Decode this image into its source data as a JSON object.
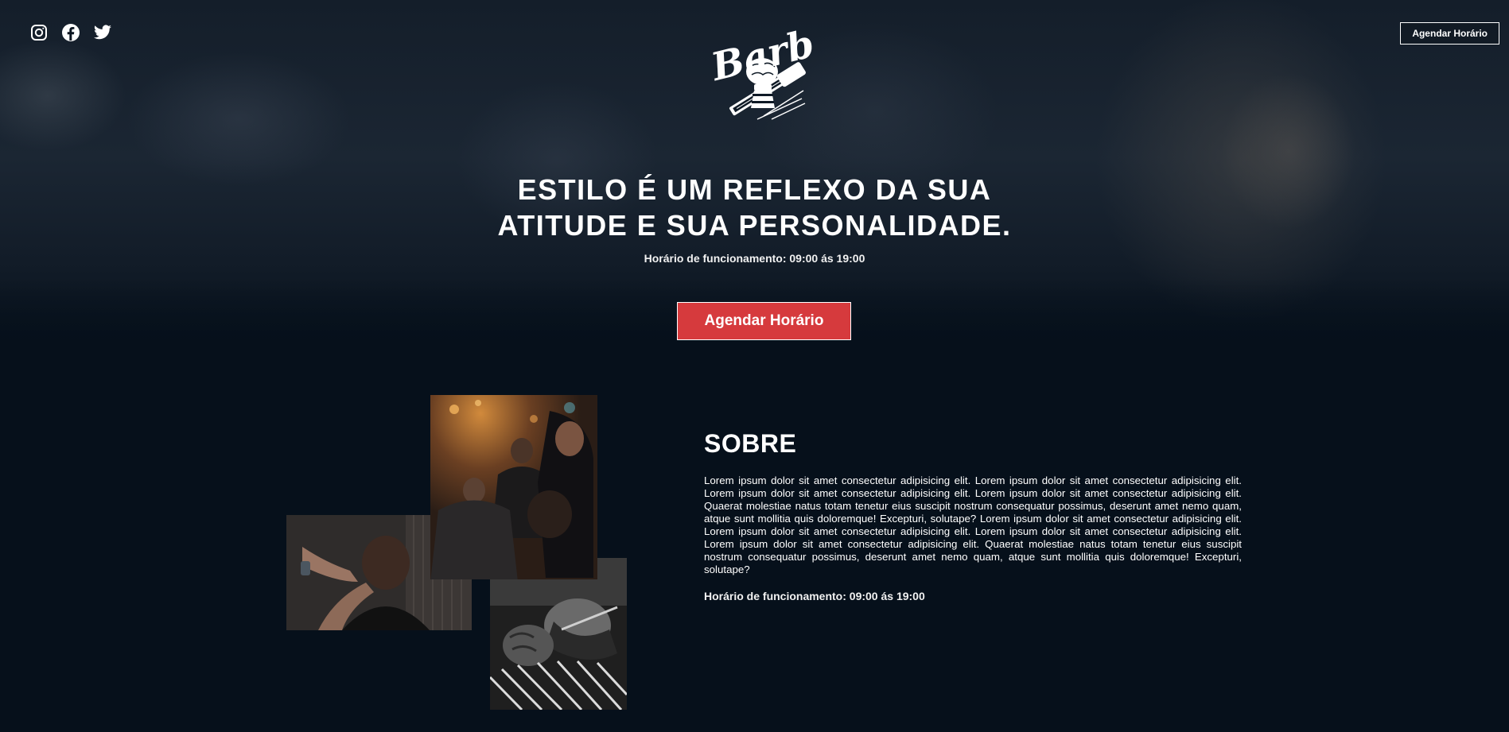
{
  "header": {
    "social": [
      {
        "name": "instagram-icon"
      },
      {
        "name": "facebook-icon"
      },
      {
        "name": "twitter-icon"
      }
    ],
    "cta_label": "Agendar Horário"
  },
  "hero": {
    "logo_text": "Barber",
    "headline_line1": "ESTILO É UM REFLEXO DA SUA",
    "headline_line2": "ATITUDE E SUA PERSONALIDADE.",
    "hours": "Horário de funcionamento: 09:00 ás 19:00",
    "cta_label": "Agendar Horário"
  },
  "about": {
    "title": "SOBRE",
    "text": "Lorem ipsum dolor sit amet consectetur adipisicing elit. Lorem ipsum dolor sit amet consectetur adipisicing elit. Lorem ipsum dolor sit amet consectetur adipisicing elit. Lorem ipsum dolor sit amet consectetur adipisicing elit. Quaerat molestiae natus totam tenetur eius suscipit nostrum consequatur possimus, deserunt amet nemo quam, atque sunt mollitia quis doloremque! Excepturi, solutape? Lorem ipsum dolor sit amet consectetur adipisicing elit. Lorem ipsum dolor sit amet consectetur adipisicing elit. Lorem ipsum dolor sit amet consectetur adipisicing elit. Lorem ipsum dolor sit amet consectetur adipisicing elit. Quaerat molestiae natus totam tenetur eius suscipit nostrum consequatur possimus, deserunt amet nemo quam, atque sunt mollitia quis doloremque! Excepturi, solutape?",
    "hours": "Horário de funcionamento: 09:00 ás 19:00"
  },
  "colors": {
    "background": "#06101b",
    "accent": "#d63a3d",
    "text": "#ffffff"
  }
}
